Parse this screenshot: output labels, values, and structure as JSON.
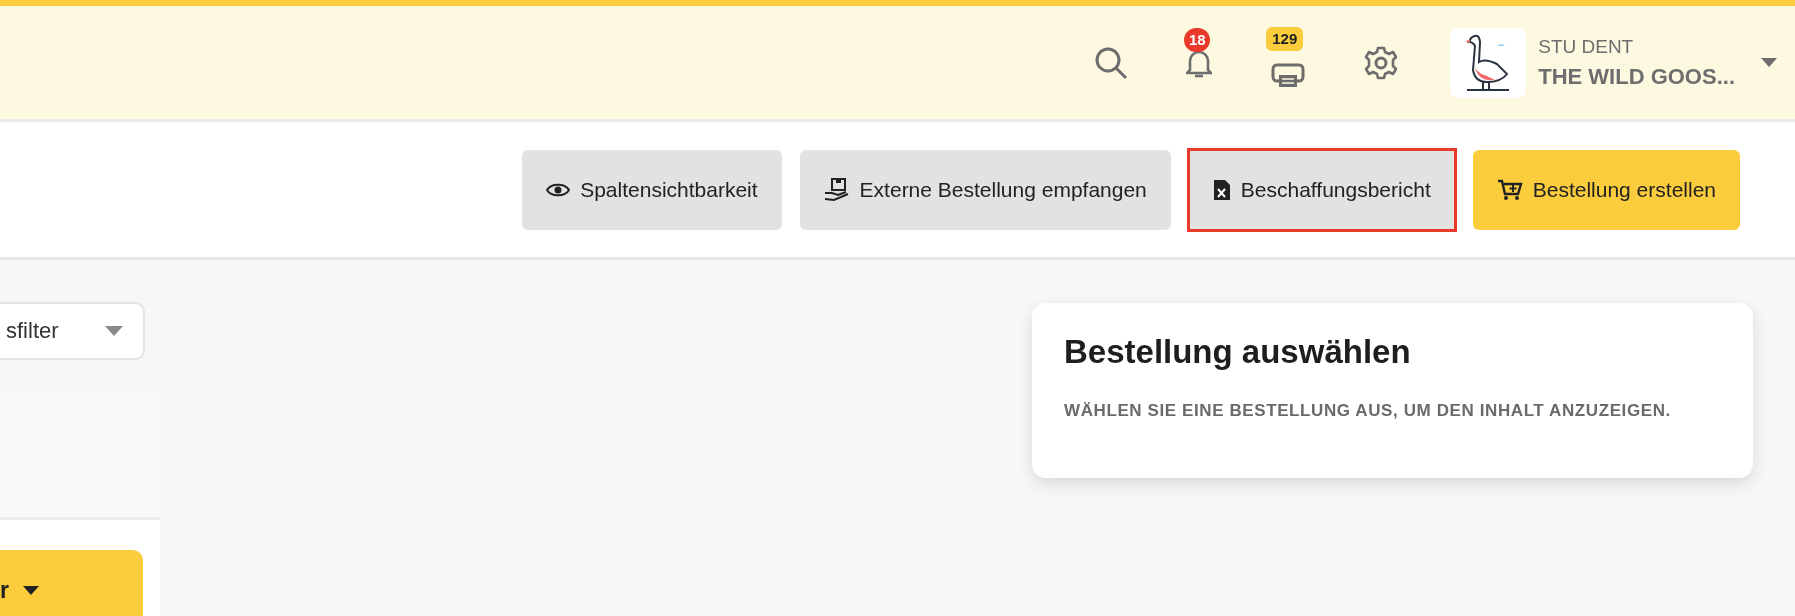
{
  "header": {
    "notifications": {
      "badge": "18"
    },
    "print_queue": {
      "badge": "129"
    },
    "user": {
      "name": "STU DENT",
      "organization": "THE WILD GOOS..."
    }
  },
  "toolbar": {
    "buttons": [
      {
        "label": "Spaltensichtbarkeit",
        "kind": "default",
        "highlighted": false
      },
      {
        "label": "Externe Bestellung empfangen",
        "kind": "default",
        "highlighted": false
      },
      {
        "label": "Beschaffungsbericht",
        "kind": "default",
        "highlighted": true
      },
      {
        "label": "Bestellung erstellen",
        "kind": "primary",
        "highlighted": false
      }
    ]
  },
  "sidebar": {
    "filter": {
      "value": "sfilter"
    },
    "action_button": {
      "label": "r"
    }
  },
  "detail_card": {
    "title": "Bestellung auswählen",
    "message": "WÄHLEN SIE EINE BESTELLUNG AUS, UM DEN INHALT ANZUZEIGEN."
  }
}
